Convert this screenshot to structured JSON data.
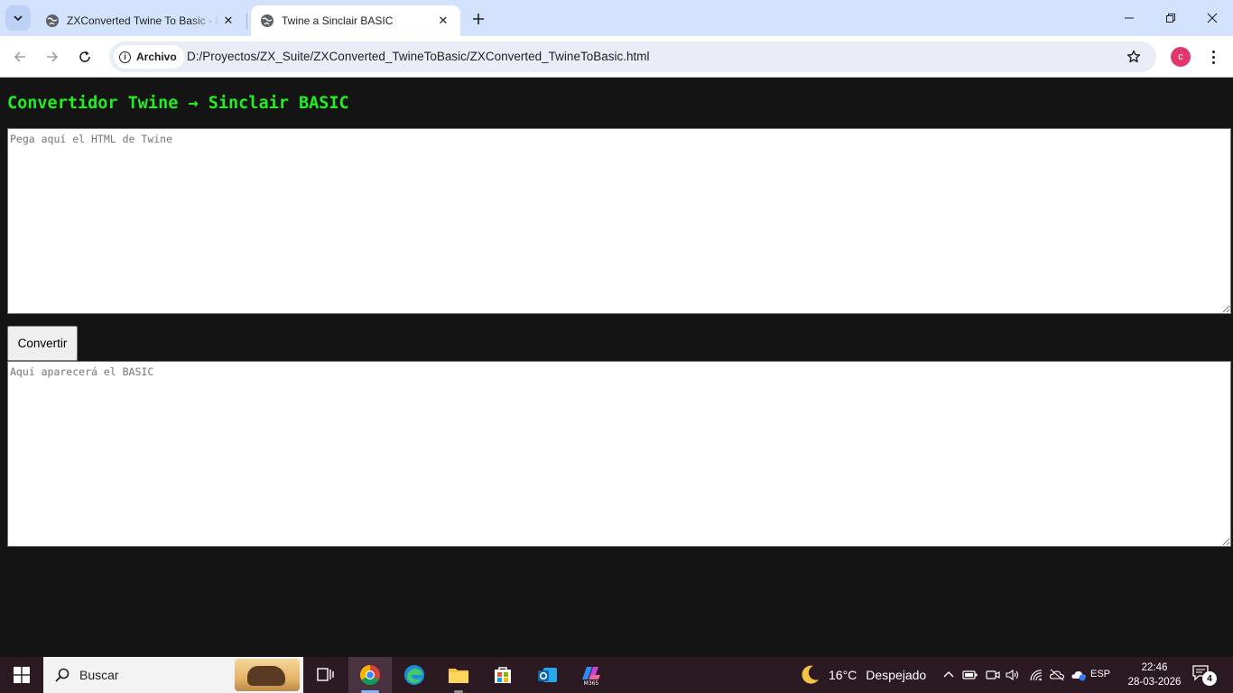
{
  "browser": {
    "tabs": [
      {
        "title": "ZXConverted Twine To Basic - L",
        "active": false
      },
      {
        "title": "Twine a Sinclair BASIC",
        "active": true
      }
    ],
    "address": {
      "security_chip": "Archivo",
      "url": "D:/Proyectos/ZX_Suite/ZXConverted_TwineToBasic/ZXConverted_TwineToBasic.html"
    },
    "profile_initial": "c"
  },
  "page": {
    "heading": "Convertidor Twine → Sinclair BASIC",
    "input": {
      "value": "",
      "placeholder": "Pega aquí el HTML de Twine"
    },
    "convert_button": "Convertir",
    "output": {
      "value": "",
      "placeholder": "Aquí aparecerá el BASIC"
    }
  },
  "taskbar": {
    "search_label": "Buscar",
    "apps": [
      "task-view-icon",
      "chrome-icon",
      "edge-icon",
      "file-explorer-icon",
      "microsoft-store-icon",
      "outlook-icon",
      "m365-icon"
    ],
    "weather": {
      "temperature": "16°C",
      "condition": "Despejado"
    },
    "language": "ESP",
    "time": "22:46",
    "date": "28-03-2026",
    "notification_count": "4"
  },
  "colors": {
    "page_background": "#141414",
    "heading": "#22ee22",
    "tabstrip": "#d3e3fd",
    "taskbar": "#2c1a22"
  }
}
